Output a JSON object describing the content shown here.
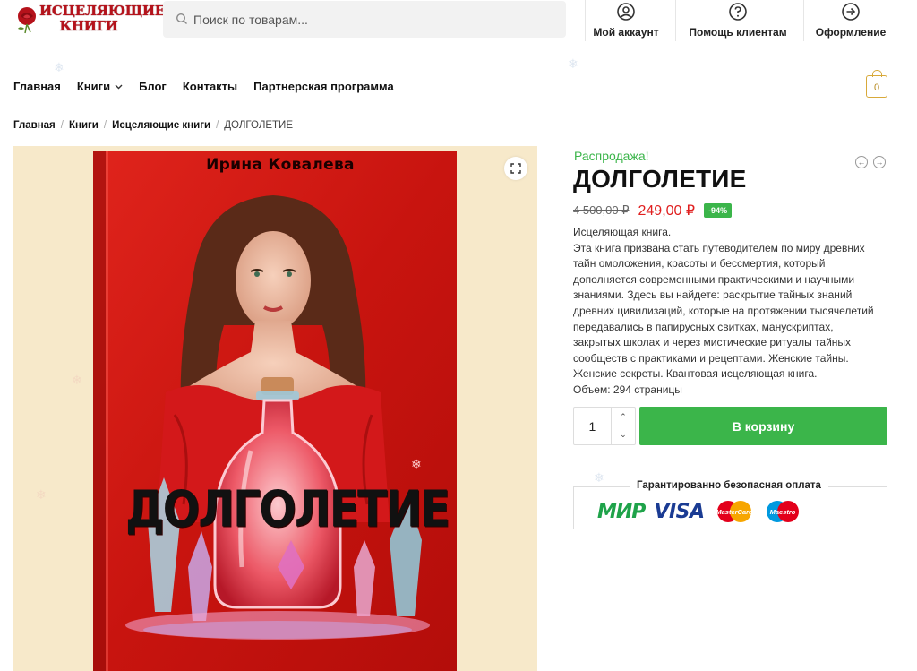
{
  "header": {
    "logo_line1": "ИСЦЕЛЯЮЩИЕ",
    "logo_line2": "КНИГИ",
    "search_placeholder": "Поиск по товарам...",
    "links": [
      {
        "label": "Мой аккаунт",
        "icon": "user-icon"
      },
      {
        "label": "Помощь клиентам",
        "icon": "help-icon"
      },
      {
        "label": "Оформление",
        "icon": "checkout-arrow-icon"
      }
    ]
  },
  "nav": {
    "items": [
      "Главная",
      "Книги",
      "Блог",
      "Контакты",
      "Партнерская программа"
    ],
    "cart_count": "0"
  },
  "breadcrumb": {
    "items": [
      "Главная",
      "Книги",
      "Исцеляющие книги"
    ],
    "current": "ДОЛГОЛЕТИЕ"
  },
  "gallery": {
    "book_author": "Ирина Ковалева",
    "book_title": "ДОЛГОЛЕТИЕ"
  },
  "product": {
    "sale_label": "Распродажа!",
    "title": "ДОЛГОЛЕТИЕ",
    "old_price": "4 500,00 ₽",
    "price": "249,00 ₽",
    "discount": "-94%",
    "description": [
      "Исцеляющая книга.",
      "Эта книга призвана стать путеводителем по миру древних",
      "тайн омоложения, красоты и бессмертия, который",
      "дополняется современными практическими и научными",
      "знаниями. Здесь вы найдете: раскрытие тайных знаний",
      "древних цивилизаций, которые на протяжении тысячелетий",
      "передавались в папирусных свитках, манускриптах,",
      "закрытых школах и через мистические ритуалы тайных",
      "сообществ с практиками и рецептами. Женские тайны.",
      "Женские секреты. Квантовая исцеляющая книга.",
      "Объем: 294 страницы"
    ],
    "quantity": "1",
    "add_to_cart": "В корзину",
    "secure_title": "Гарантированно безопасная оплата",
    "payment_logos": [
      "МИР",
      "VISA",
      "MasterCard",
      "Maestro"
    ]
  },
  "colors": {
    "accent_green": "#3bb54a",
    "sale_red": "#e02020",
    "logo_red": "#b5121b",
    "gallery_bg": "#f7e9ca"
  }
}
